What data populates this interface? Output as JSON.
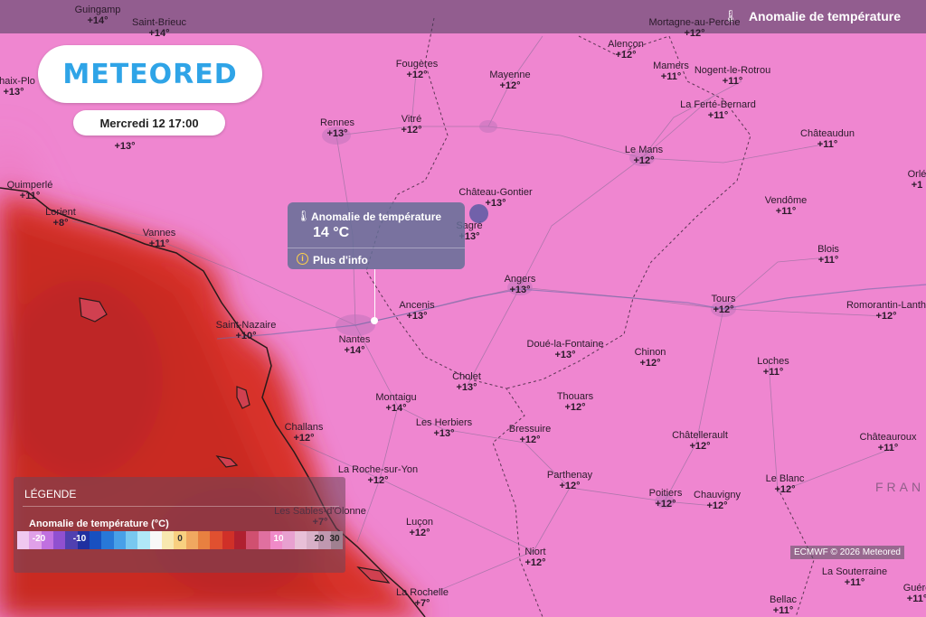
{
  "header": {
    "layer_title": "Anomalie de température",
    "layer_icon": "thermometer-icon"
  },
  "brand": {
    "logo_text": "METEORED",
    "accent": "#2fa4e7"
  },
  "datetime": "Mercredi 12 17:00",
  "popup": {
    "title": "Anomalie de température",
    "value": "14 °C",
    "more_info": "Plus d'info",
    "title_icon": "thermometer-icon",
    "info_icon": "info-icon"
  },
  "legend": {
    "title": "LÉGENDE",
    "variable": "Anomalie de température (°C)",
    "ticks": [
      "-20",
      "-10",
      "0",
      "10",
      "20",
      "30"
    ],
    "colors": [
      "#f0c8f0",
      "#e0a0e8",
      "#c070e0",
      "#9050d0",
      "#5040b0",
      "#2030a0",
      "#1850c0",
      "#2878d8",
      "#48a0e8",
      "#78c8f0",
      "#b0e8f8",
      "#f8f8f8",
      "#f8e8b0",
      "#f8d080",
      "#f0a860",
      "#e88040",
      "#e05030",
      "#d03028",
      "#b02030",
      "#d05070",
      "#e070a0",
      "#f08ac8",
      "#e8a0d0",
      "#e8c0d8",
      "#d8b0c8",
      "#c098b0",
      "#a08090"
    ]
  },
  "credit": "ECMWF © 2026 Meteored",
  "region_label": "FRAN",
  "cities": [
    {
      "name": "Guingamp",
      "val": "+14°"
    },
    {
      "name": "Saint-Brieuc",
      "val": "+14°"
    },
    {
      "name": "Mortagne-au-Perche",
      "val": "+12°"
    },
    {
      "name": "Alençon",
      "val": "+12°"
    },
    {
      "name": "Fougères",
      "val": "+12°"
    },
    {
      "name": "Mayenne",
      "val": "+12°"
    },
    {
      "name": "Mamers",
      "val": "+11°"
    },
    {
      "name": "Nogent-le-Rotrou",
      "val": "+11°"
    },
    {
      "name": "Chaix-Plo",
      "val": "+13°"
    },
    {
      "name": "Rennes",
      "val": "+13°"
    },
    {
      "name": "Vitré",
      "val": "+12°"
    },
    {
      "name": "La Ferté-Bernard",
      "val": "+11°"
    },
    {
      "name": "Châteaudun",
      "val": "+11°"
    },
    {
      "name": "Le Mans",
      "val": "+12°"
    },
    {
      "name": "",
      "val": "+13°"
    },
    {
      "name": "Quimperlé",
      "val": "+11°"
    },
    {
      "name": "Château-Gontier",
      "val": "+13°"
    },
    {
      "name": "Orlé",
      "val": "+1"
    },
    {
      "name": "Lorient",
      "val": "+8°"
    },
    {
      "name": "Vendôme",
      "val": "+11°"
    },
    {
      "name": "Sagré",
      "val": "+13°"
    },
    {
      "name": "Vannes",
      "val": "+11°"
    },
    {
      "name": "Blois",
      "val": "+11°"
    },
    {
      "name": "Angers",
      "val": "+13°"
    },
    {
      "name": "Romorantin-Lanth",
      "val": "+12°"
    },
    {
      "name": "Ancenis",
      "val": "+13°"
    },
    {
      "name": "Tours",
      "val": "+12°"
    },
    {
      "name": "Saint-Nazaire",
      "val": "+10°"
    },
    {
      "name": "Nantes",
      "val": "+14°"
    },
    {
      "name": "Doué-la-Fontaine",
      "val": "+13°"
    },
    {
      "name": "Chinon",
      "val": "+12°"
    },
    {
      "name": "Loches",
      "val": "+11°"
    },
    {
      "name": "Cholet",
      "val": "+13°"
    },
    {
      "name": "Montaigu",
      "val": "+14°"
    },
    {
      "name": "Thouars",
      "val": "+12°"
    },
    {
      "name": "Les Herbiers",
      "val": "+13°"
    },
    {
      "name": "Bressuire",
      "val": "+12°"
    },
    {
      "name": "Châtellerault",
      "val": "+12°"
    },
    {
      "name": "Châteauroux",
      "val": "+11°"
    },
    {
      "name": "Challans",
      "val": "+12°"
    },
    {
      "name": "La Roche-sur-Yon",
      "val": "+12°"
    },
    {
      "name": "Parthenay",
      "val": "+12°"
    },
    {
      "name": "Le Blanc",
      "val": "+12°"
    },
    {
      "name": "Poitiers",
      "val": "+12°"
    },
    {
      "name": "Chauvigny",
      "val": "+12°"
    },
    {
      "name": "Les Sables-d'Olonne",
      "val": "+7°"
    },
    {
      "name": "Luçon",
      "val": "+12°"
    },
    {
      "name": "Niort",
      "val": "+12°"
    },
    {
      "name": "La Souterraine",
      "val": "+11°"
    },
    {
      "name": "La Rochelle",
      "val": "+7°"
    },
    {
      "name": "Bellac",
      "val": "+11°"
    },
    {
      "name": "Guére",
      "val": "+11°"
    }
  ]
}
